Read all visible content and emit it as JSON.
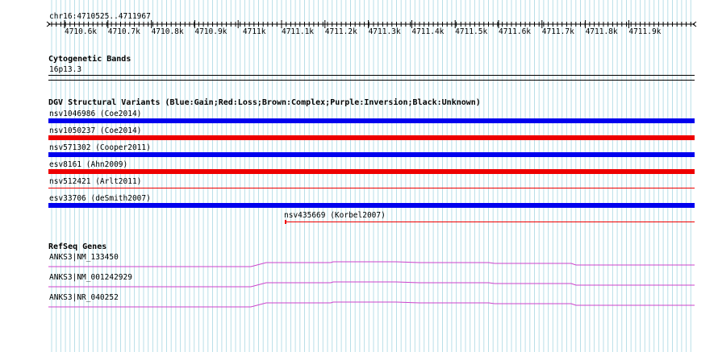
{
  "ruler": {
    "region_label": "chr16:4710525..4711967",
    "ticks": [
      "4710.6k",
      "4710.7k",
      "4710.8k",
      "4710.9k",
      "4711k",
      "4711.1k",
      "4711.2k",
      "4711.3k",
      "4711.4k",
      "4711.5k",
      "4711.6k",
      "4711.7k",
      "4711.8k",
      "4711.9k"
    ]
  },
  "cytobands": {
    "title": "Cytogenetic Bands",
    "band": "16p13.3"
  },
  "dgv": {
    "title": "DGV Structural Variants (Blue:Gain;Red:Loss;Brown:Complex;Purple:Inversion;Black:Unknown)",
    "variants": [
      {
        "label": "nsv1046986 (Coe2014)",
        "color": "#0000ee",
        "style": "thick"
      },
      {
        "label": "nsv1050237 (Coe2014)",
        "color": "#ee0000",
        "style": "thick"
      },
      {
        "label": "nsv571302 (Cooper2011)",
        "color": "#0000ee",
        "style": "thick"
      },
      {
        "label": "esv8161 (Ahn2009)",
        "color": "#ee0000",
        "style": "thick"
      },
      {
        "label": "nsv512421 (Arlt2011)",
        "color": "#ee0000",
        "style": "thin"
      },
      {
        "label": "esv33706 (deSmith2007)",
        "color": "#0000ee",
        "style": "thick"
      },
      {
        "label": "nsv435669 (Korbel2007)",
        "color": "#ee0000",
        "style": "thin-partial"
      }
    ]
  },
  "refseq": {
    "title": "RefSeq Genes",
    "color": "#cc44cc",
    "genes": [
      "ANKS3|NM_133450",
      "ANKS3|NM_001242929",
      "ANKS3|NR_040252"
    ]
  }
}
